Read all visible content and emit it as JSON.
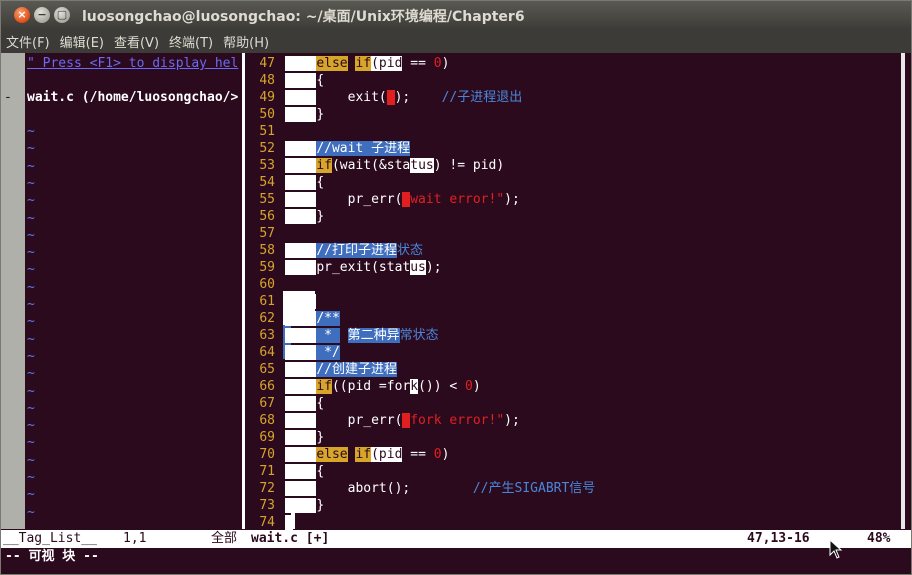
{
  "window": {
    "title": "luosongchao@luosongchao: ~/桌面/Unix环境编程/Chapter6",
    "buttons": {
      "close": "×",
      "minimize": "−",
      "maximize": "▢"
    }
  },
  "menu": {
    "items": [
      "文件(F)",
      "编辑(E)",
      "查看(V)",
      "终端(T)",
      "帮助(H)"
    ]
  },
  "taglist": {
    "hint": "\" Press <F1> to display hel",
    "file_marker": "-",
    "file_label": "wait.c (/home/luosongchao/>",
    "tilde": "~"
  },
  "code": {
    "lines": [
      {
        "n": "47",
        "t": "else if(pid == 0)"
      },
      {
        "n": "48",
        "t": "{"
      },
      {
        "n": "49",
        "t": "exit(1);    //子进程退出"
      },
      {
        "n": "50",
        "t": "}"
      },
      {
        "n": "51",
        "t": ""
      },
      {
        "n": "52",
        "t": "//wait 子进程"
      },
      {
        "n": "53",
        "t": "if(wait(&status) != pid)"
      },
      {
        "n": "54",
        "t": "{"
      },
      {
        "n": "55",
        "t": "pr_err(\"wait error!\");"
      },
      {
        "n": "56",
        "t": "}"
      },
      {
        "n": "57",
        "t": ""
      },
      {
        "n": "58",
        "t": "//打印子进程状态"
      },
      {
        "n": "59",
        "t": "pr_exit(status);"
      },
      {
        "n": "60",
        "t": ""
      },
      {
        "n": "61",
        "t": ""
      },
      {
        "n": "62",
        "t": "/**"
      },
      {
        "n": "63",
        "t": " *  第二种异常状态"
      },
      {
        "n": "64",
        "t": " */"
      },
      {
        "n": "65",
        "t": "//创建子进程"
      },
      {
        "n": "66",
        "t": "if((pid =fork()) < 0)"
      },
      {
        "n": "67",
        "t": "{"
      },
      {
        "n": "68",
        "t": "pr_err(\"fork error!\");"
      },
      {
        "n": "69",
        "t": "}"
      },
      {
        "n": "70",
        "t": "else if(pid == 0)"
      },
      {
        "n": "71",
        "t": "{"
      },
      {
        "n": "72",
        "t": "abort();       //产生SIGABRT信号"
      },
      {
        "n": "73",
        "t": "}"
      },
      {
        "n": "74",
        "t": ""
      }
    ]
  },
  "status": {
    "taglist_name": "__Tag_List__",
    "taglist_pos": "1,1",
    "taglist_all": "全部",
    "file": "wait.c [+]",
    "cursor_pos": "47,13-16",
    "percent": "48%"
  },
  "cmdline": "-- 可视 块 --",
  "colors": {
    "terminal_bg": "#2c0a1e",
    "line_number": "#d6a52a",
    "keyword": "#d6a52a",
    "comment": "#4a86d8",
    "string": "#e02020",
    "visual_selection": "#3e6ebd"
  }
}
